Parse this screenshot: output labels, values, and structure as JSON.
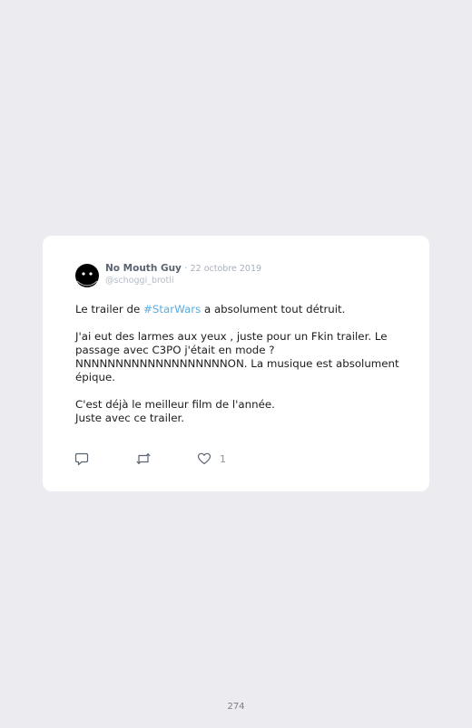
{
  "tweet": {
    "author_name": "No Mouth Guy",
    "separator": "·",
    "date": "22 octobre 2019",
    "handle": "@schoggi_brotli",
    "text": {
      "line1_before": "Le trailer de ",
      "hashtag": "#StarWars",
      "line1_after": " a absolument tout détruit.",
      "paragraph2": "J'ai eut des larmes aux yeux , juste pour un Fkin trailer. Le passage avec C3PO j'était en mode ?NNNNNNNNNNNNNNNNNNNON. La musique est absolument épique.",
      "paragraph3_line1": "C'est déjà le meilleur film de l'année.",
      "paragraph3_line2": "Juste avec ce trailer."
    },
    "actions": {
      "reply_icon": "reply-icon",
      "retweet_icon": "retweet-icon",
      "like_icon": "heart-icon",
      "like_count": "1"
    }
  },
  "page": {
    "number": "274"
  },
  "colors": {
    "background": "#ebebf0",
    "card": "#ffffff",
    "hashtag": "#5aacdf",
    "name": "#5a6470",
    "muted": "#a8b0ba"
  }
}
